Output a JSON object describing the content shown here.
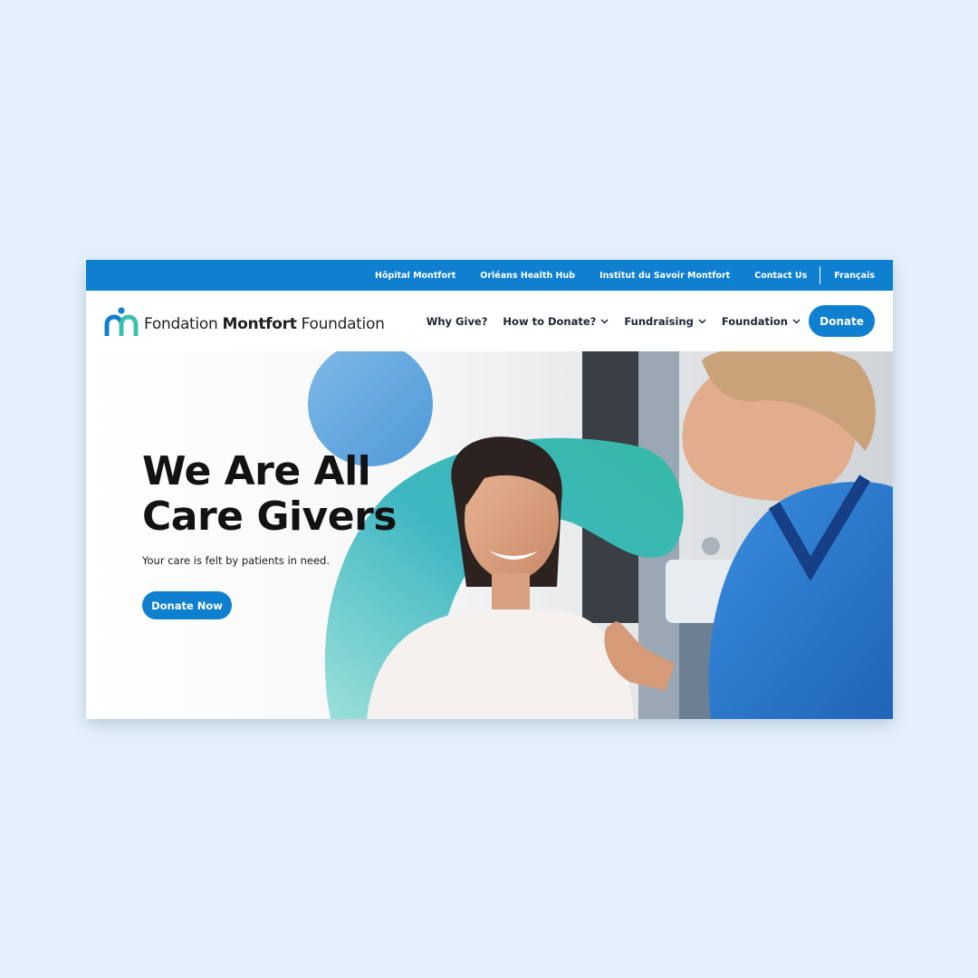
{
  "topbar": {
    "links": [
      "Hôpital Montfort",
      "Orléans Health Hub",
      "Institut du Savoir Montfort",
      "Contact Us"
    ],
    "language": "Français"
  },
  "logo": {
    "word1": "Fondation",
    "word2": "Montfort",
    "word3": "Foundation"
  },
  "nav": {
    "items": [
      "Why Give?",
      "How to Donate?",
      "Fundraising",
      "Foundation"
    ],
    "donate_label": "Donate"
  },
  "hero": {
    "title": "We Are All Care Givers",
    "subtitle": "Your care is felt by patients in need.",
    "cta_label": "Donate Now"
  },
  "colors": {
    "background": "#e4f1fb",
    "brand_blue": "#0f7fcf",
    "teal": "#3cc0b0",
    "scrubs_blue": "#2a7bd0"
  }
}
